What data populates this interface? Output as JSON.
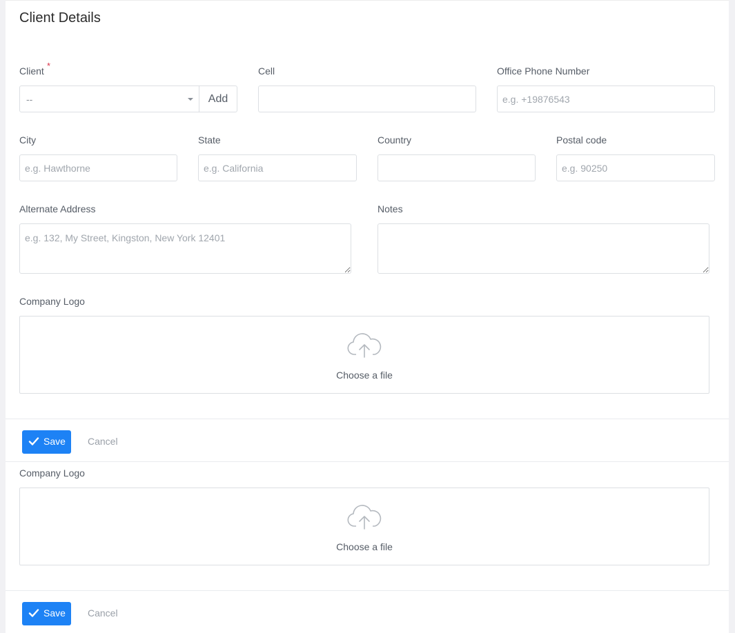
{
  "page": {
    "title": "Client Details"
  },
  "form": {
    "client": {
      "label": "Client",
      "required_mark": "*",
      "selected": "--",
      "add_label": "Add"
    },
    "cell": {
      "label": "Cell",
      "value": "",
      "placeholder": ""
    },
    "office_phone": {
      "label": "Office Phone Number",
      "placeholder": "e.g. +19876543"
    },
    "city": {
      "label": "City",
      "placeholder": "e.g. Hawthorne"
    },
    "state": {
      "label": "State",
      "placeholder": "e.g. California"
    },
    "country": {
      "label": "Country",
      "placeholder": ""
    },
    "postal_code": {
      "label": "Postal code",
      "placeholder": "e.g. 90250"
    },
    "alternate_address": {
      "label": "Alternate Address",
      "placeholder": "e.g. 132, My Street, Kingston, New York 12401"
    },
    "notes": {
      "label": "Notes",
      "placeholder": ""
    },
    "company_logo": {
      "label": "Company Logo",
      "dropzone_text": "Choose a file",
      "icon": "cloud-upload-icon"
    }
  },
  "actions": {
    "save_label": "Save",
    "cancel_label": "Cancel",
    "save_color": "#1d82f5"
  },
  "duplicate_section": {
    "company_logo": {
      "label": "Company Logo",
      "dropzone_text": "Choose a file",
      "icon": "cloud-upload-icon"
    },
    "actions": {
      "save_label": "Save",
      "cancel_label": "Cancel"
    }
  }
}
